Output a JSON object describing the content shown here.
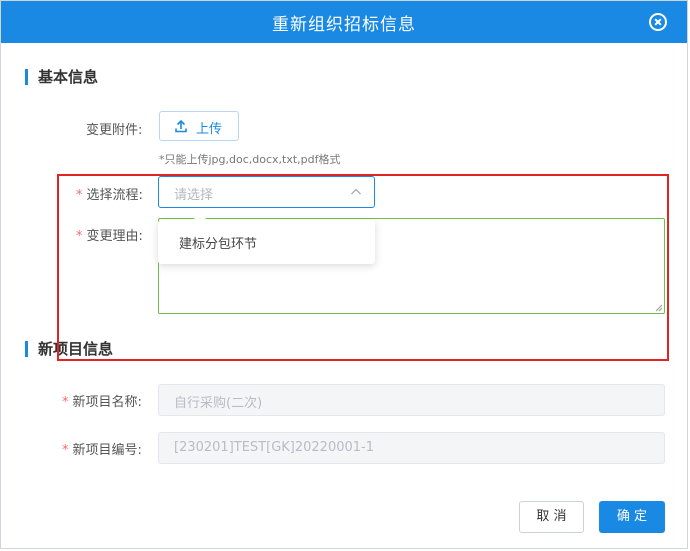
{
  "dialog": {
    "title": "重新组织招标信息",
    "close_icon": "close-circle-icon"
  },
  "basic_info": {
    "section_title": "基本信息",
    "attachment_label": "变更附件:",
    "upload_label": "上传",
    "upload_hint": "*只能上传jpg,doc,docx,txt,pdf格式",
    "process_label": "选择流程:",
    "process_placeholder": "请选择",
    "process_options": [
      "建标分包环节"
    ],
    "reason_label": "变更理由:"
  },
  "new_project": {
    "section_title": "新项目信息",
    "name_label": "新项目名称:",
    "name_value": "自行采购(二次)",
    "code_label": "新项目编号:",
    "code_value": "[230201]TEST[GK]20220001-1"
  },
  "footer": {
    "cancel_label": "取 消",
    "confirm_label": "确 定"
  },
  "colors": {
    "accent": "#1a89e3",
    "required": "#f56c6c",
    "valid_border": "#6cc04a",
    "highlight": "#e02424"
  }
}
